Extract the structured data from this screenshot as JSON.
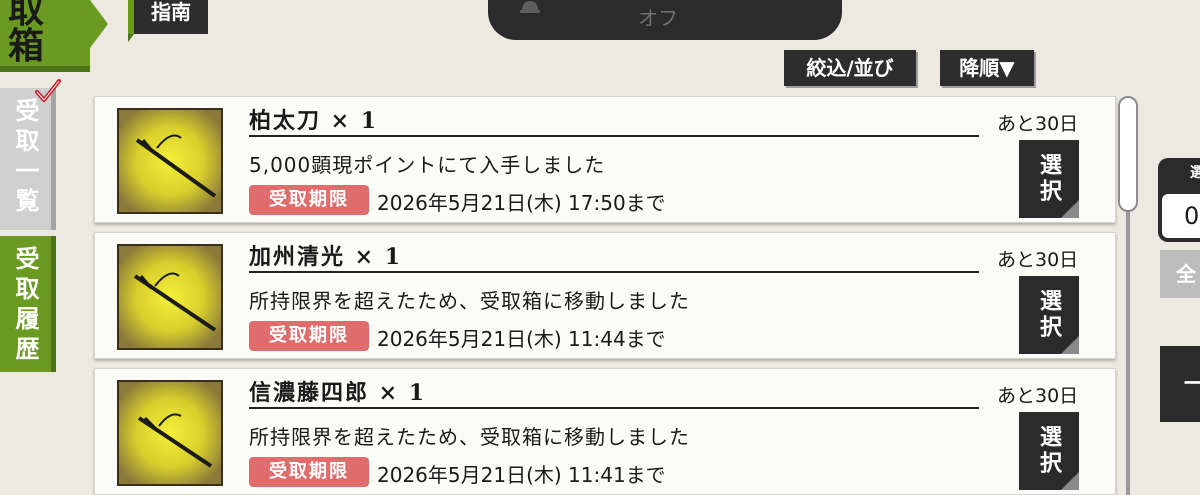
{
  "header": {
    "title": "取箱",
    "guide_label": "指南"
  },
  "notification": {
    "status_text": "オフ"
  },
  "controls": {
    "filter_label": "絞込/並び",
    "sort_label": "降順▼"
  },
  "side_tabs": {
    "list_label": "受取一覧",
    "history_label": "受取履歴"
  },
  "items": [
    {
      "name": "柏太刀 × 1",
      "description": "5,000顕現ポイントにて入手しました",
      "deadline_badge": "受取期限",
      "deadline": "2026年5月21日(木) 17:50まで",
      "remaining": "あと30日",
      "select_label": "選択"
    },
    {
      "name": "加州清光 × 1",
      "description": "所持限界を超えたため、受取箱に移動しました",
      "deadline_badge": "受取期限",
      "deadline": "2026年5月21日(木) 11:44まで",
      "remaining": "あと30日",
      "select_label": "選択"
    },
    {
      "name": "信濃藤四郎 × 1",
      "description": "所持限界を超えたため、受取箱に移動しました",
      "deadline_badge": "受取期限",
      "deadline": "2026年5月21日(木) 11:41まで",
      "remaining": "あと30日",
      "select_label": "選択"
    }
  ],
  "right_panel": {
    "label_fragment": "選",
    "value_fragment": "0",
    "grey_button_fragment": "全",
    "dark_button_fragment": "一"
  },
  "colors": {
    "accent_green": "#6b9a23",
    "badge_red": "#e06d6d",
    "dark": "#2b2b2b",
    "background": "#ece9e1"
  },
  "icons": [
    "bell-icon",
    "check-icon",
    "sword-icon"
  ]
}
